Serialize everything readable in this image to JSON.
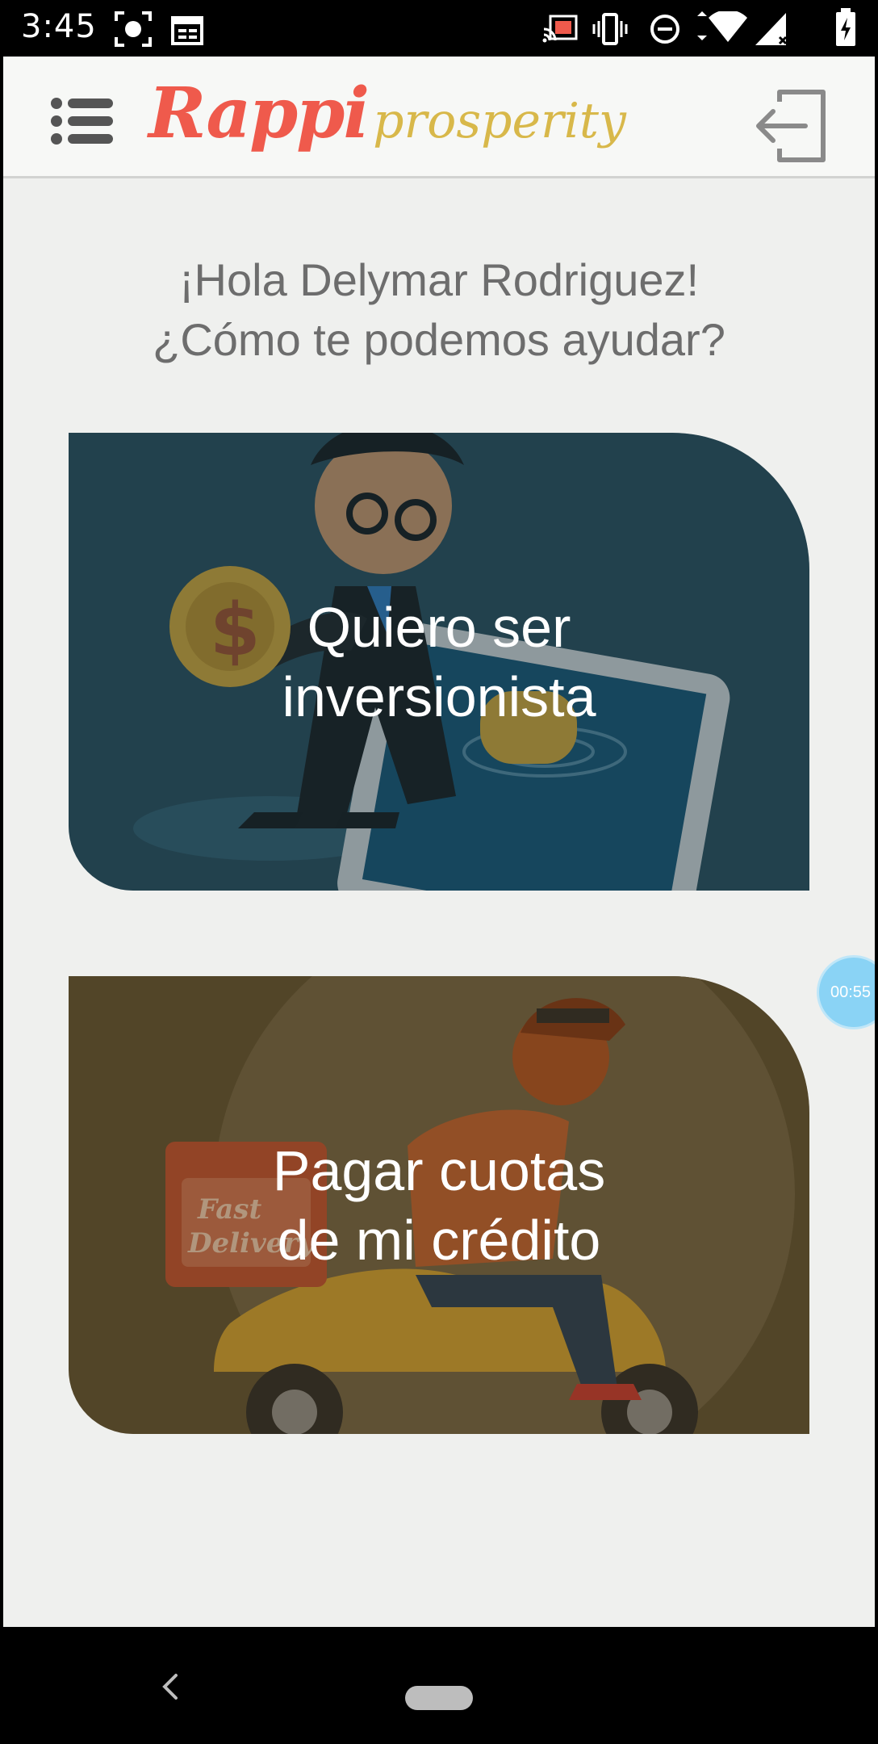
{
  "status_bar": {
    "time": "3:45",
    "icons": [
      "screenshot-icon",
      "calendar-icon",
      "cast-icon",
      "vibrate-icon",
      "do-not-disturb-icon",
      "wifi-icon",
      "signal-icon",
      "battery-icon"
    ]
  },
  "header": {
    "logo_primary": "Rappi",
    "logo_secondary": "prosperity",
    "menu_icon": "list-menu-icon",
    "logout_icon": "logout-icon"
  },
  "greeting": {
    "line1": "¡Hola Delymar Rodriguez!",
    "line2": "¿Cómo te podemos ayudar?"
  },
  "cards": [
    {
      "line1": "Quiero ser",
      "line2": "inversionista",
      "bg_color": "#24424f"
    },
    {
      "line1": "Pagar cuotas",
      "line2": "de mi crédito",
      "bg_color": "#574a2d"
    }
  ],
  "timer_bubble": {
    "text": "00:55"
  },
  "nav_bar": {
    "back_icon": "back-chevron-icon",
    "home_icon": "home-pill-icon"
  },
  "colors": {
    "brand_red": "#ef5a4c",
    "brand_gold": "#d8b84a",
    "background": "#eff0ee",
    "timer_blue": "#8ad3f5"
  }
}
